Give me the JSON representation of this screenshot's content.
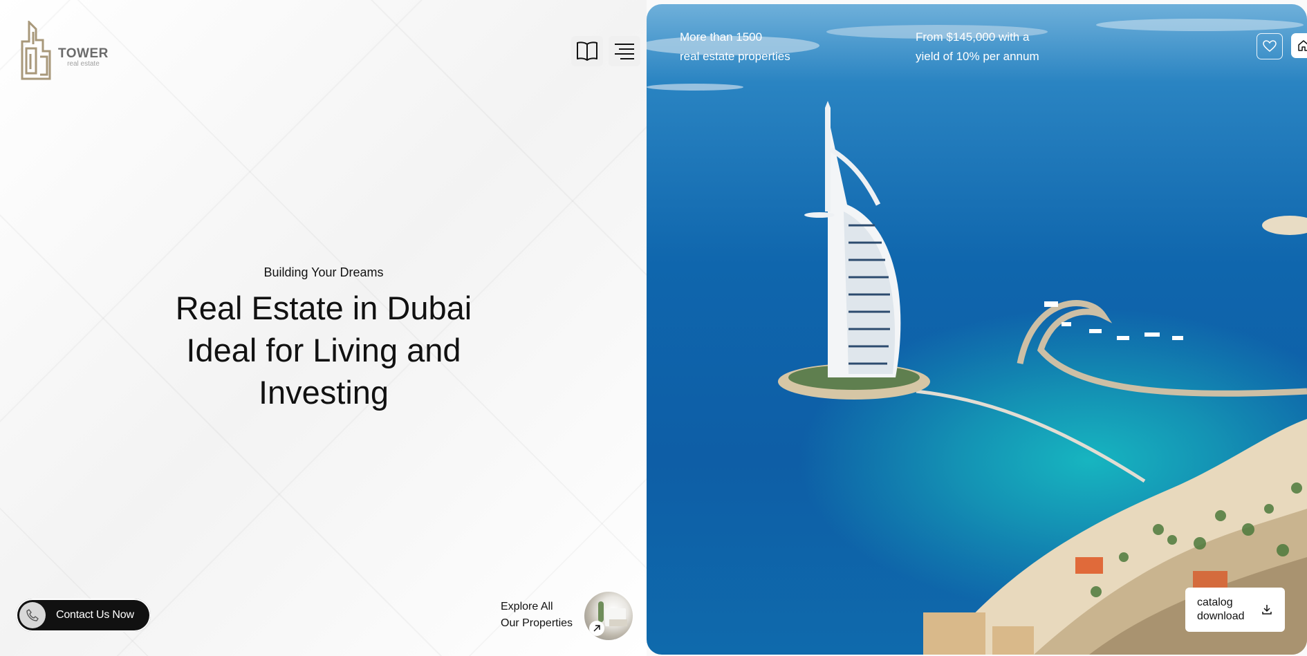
{
  "brand": {
    "name": "TOWER",
    "tagline": "real estate"
  },
  "header": {
    "catalog_icon": "book-icon",
    "menu_icon": "menu-icon"
  },
  "hero": {
    "kicker": "Building Your Dreams",
    "title_line1": "Real Estate in Dubai",
    "title_line2": "Ideal for Living and",
    "title_line3": "Investing"
  },
  "contact": {
    "label": "Contact Us Now",
    "icon": "phone-icon"
  },
  "explore": {
    "line1": "Explore All",
    "line2": "Our Properties",
    "icon": "arrow-up-right-icon"
  },
  "panel": {
    "stat1_line1": "More than 1500",
    "stat1_line2": "real estate properties",
    "stat2_line1": "From $145,000 with a",
    "stat2_line2": "yield of 10% per annum",
    "favorite_icon": "heart-icon",
    "home_icon": "home-icon",
    "catalog_line1": "catalog",
    "catalog_line2": "download",
    "download_icon": "download-icon"
  },
  "colors": {
    "brand_gold": "#a8987a",
    "dark": "#111111",
    "sea": "#0f66ad"
  }
}
